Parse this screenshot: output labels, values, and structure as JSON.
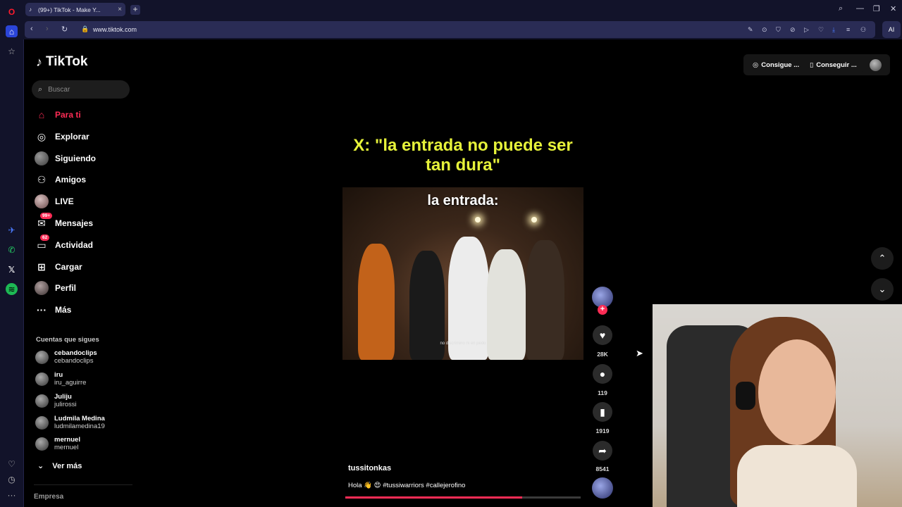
{
  "browser": {
    "tab_title": "(99+) TikTok - Make Y...",
    "url": "www.tiktok.com",
    "ai_label": "AI"
  },
  "tiktok": {
    "logo": "TikTok",
    "search_placeholder": "Buscar",
    "top_buttons": [
      "Consigue ...",
      "Conseguir ..."
    ],
    "nav": [
      {
        "label": "Para ti",
        "icon": "home-icon",
        "active": true
      },
      {
        "label": "Explorar",
        "icon": "compass-icon"
      },
      {
        "label": "Siguiendo",
        "icon": "following-avatar"
      },
      {
        "label": "Amigos",
        "icon": "friends-icon"
      },
      {
        "label": "LIVE",
        "icon": "live-avatar"
      },
      {
        "label": "Mensajes",
        "icon": "messages-icon",
        "badge": "99+"
      },
      {
        "label": "Actividad",
        "icon": "activity-icon",
        "badge": "62"
      },
      {
        "label": "Cargar",
        "icon": "upload-icon"
      },
      {
        "label": "Perfil",
        "icon": "profile-avatar"
      },
      {
        "label": "Más",
        "icon": "more-icon"
      }
    ],
    "following_title": "Cuentas que sigues",
    "following": [
      {
        "name": "cebandoclips",
        "handle": "cebandoclips"
      },
      {
        "name": "iru",
        "handle": "iru_aguirre"
      },
      {
        "name": "Juliju",
        "handle": "julirossi"
      },
      {
        "name": "Ludmila Medina",
        "handle": "ludmilamedina19"
      },
      {
        "name": "mernuel",
        "handle": "mernuel"
      }
    ],
    "see_more": "Ver más",
    "company": "Empresa",
    "video": {
      "top_caption": "X: \"la entrada no puede ser tan dura\"",
      "in_video_text": "la entrada:",
      "subtitle": "no discrimino ni en pedo",
      "author": "tussitonkas",
      "description": "Hola 👋 😍 #tussiwarriors #callejerofino",
      "progress": 0.75
    },
    "actions": {
      "likes": "28K",
      "comments": "119",
      "saves": "1919",
      "shares": "8541"
    }
  },
  "colors": {
    "accent": "#fe2c55",
    "caption_yellow": "#e6f23a",
    "browser_bg": "#12132a"
  }
}
